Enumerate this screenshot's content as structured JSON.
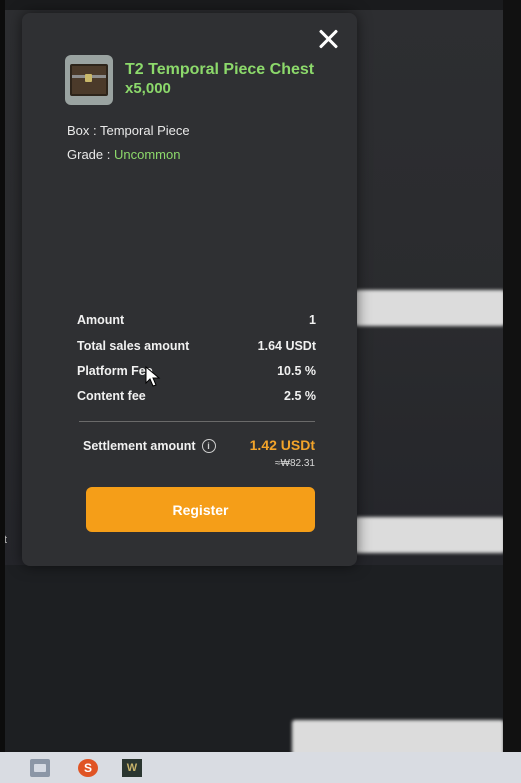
{
  "modal": {
    "item": {
      "name": "T2 Temporal Piece Chest",
      "quantity": "x5,000",
      "icon": "treasure-chest-icon"
    },
    "box_label": "Box : Temporal Piece",
    "grade_prefix": "Grade : ",
    "grade_value": "Uncommon",
    "summary": [
      {
        "label": "Amount",
        "value": "1"
      },
      {
        "label": "Total sales amount",
        "value": "1.64 USDt"
      },
      {
        "label": "Platform Fee",
        "value": "10.5 %"
      },
      {
        "label": "Content fee",
        "value": "2.5 %"
      }
    ],
    "settlement": {
      "label": "Settlement amount",
      "value": "1.42 USDt",
      "approx": "≈₩82.31"
    },
    "register_button": "Register",
    "colors": {
      "accent_green": "#8cd96b",
      "accent_orange": "#f59e18",
      "panel": "#2f3033"
    }
  },
  "background": {
    "edge_text": "t"
  },
  "taskbar": {
    "icons": [
      "file-explorer-icon",
      "s-app-icon",
      "game-app-icon"
    ],
    "s_label": "S",
    "game_label": "W"
  }
}
